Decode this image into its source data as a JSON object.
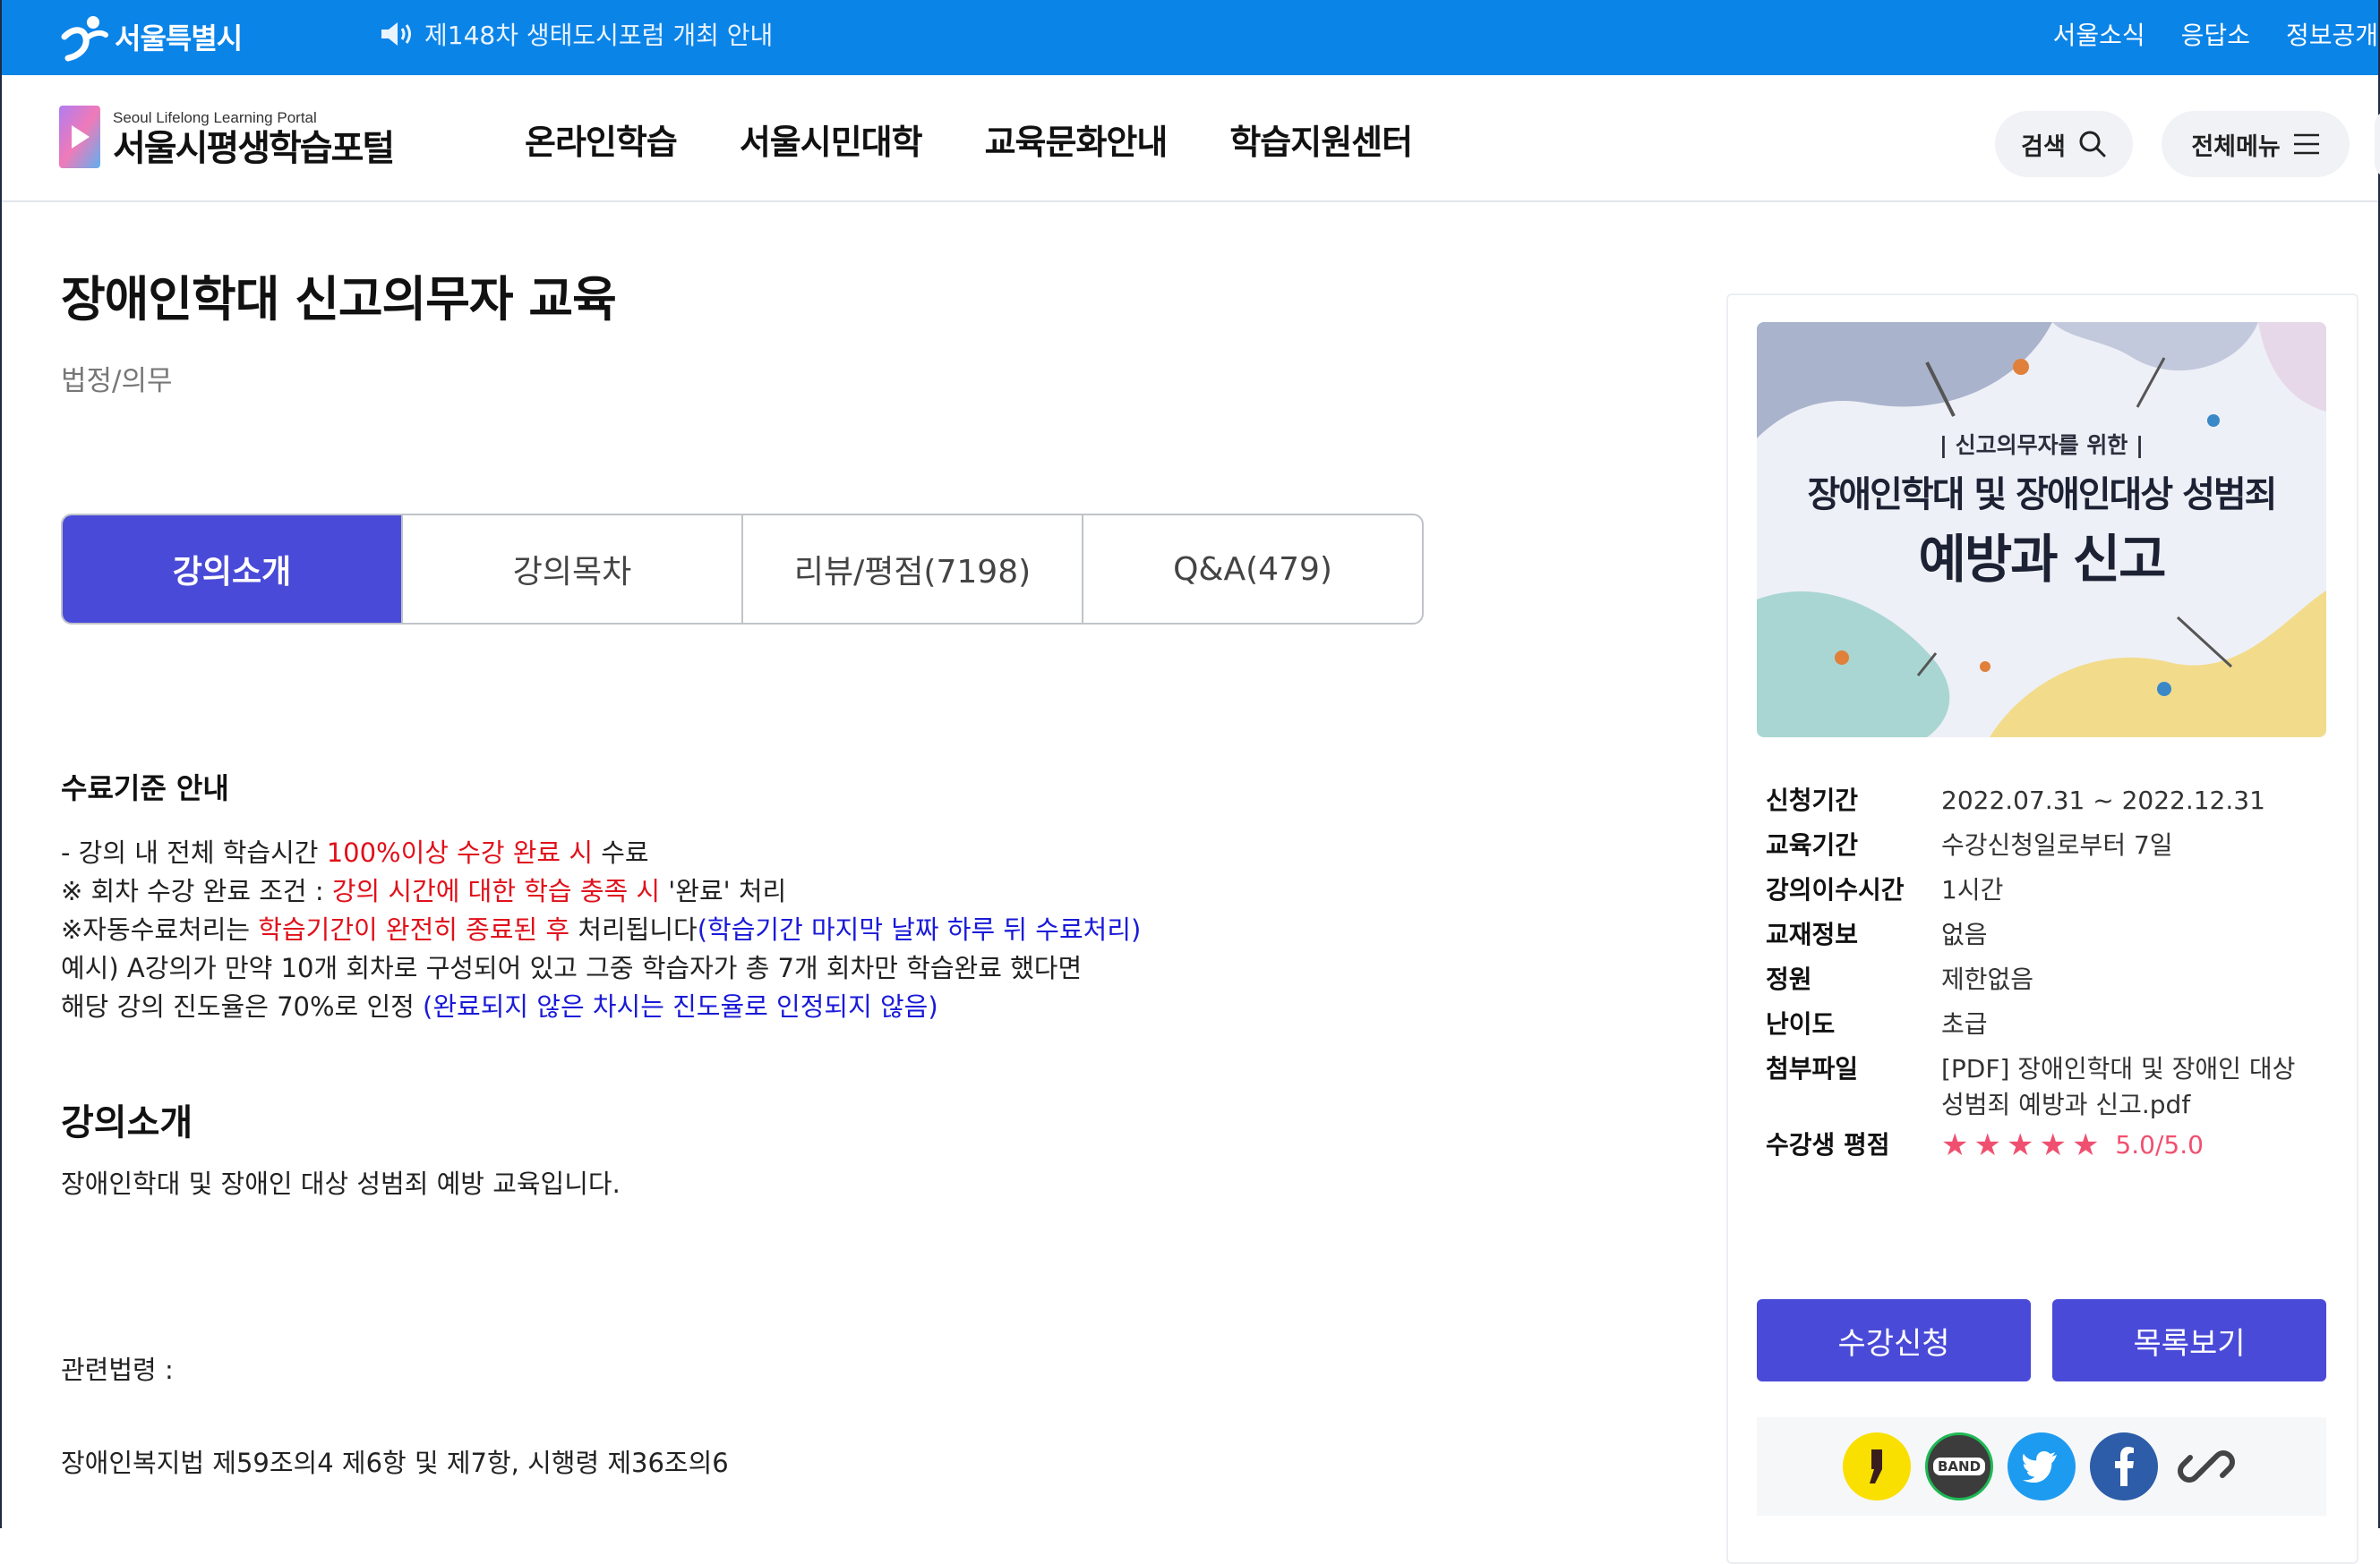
{
  "topbar": {
    "logo_text": "서울특별시",
    "notice": "제148차 생태도시포럼 개최 안내",
    "links": [
      "서울소식",
      "응답소",
      "정보공개"
    ]
  },
  "header": {
    "portal_sub": "Seoul Lifelong Learning Portal",
    "portal_name": "서울시평생학습포털",
    "nav": [
      "온라인학습",
      "서울시민대학",
      "교육문화안내",
      "학습지원센터"
    ],
    "search_label": "검색",
    "menu_label": "전체메뉴"
  },
  "course": {
    "title": "장애인학대 신고의무자 교육",
    "category": "법정/의무"
  },
  "tabs": [
    "강의소개",
    "강의목차",
    "리뷰/평점(7198)",
    "Q&A(479)"
  ],
  "criteria": {
    "title": "수료기준 안내",
    "l1a": "- 강의 내 전체 학습시간 ",
    "l1b": "100%이상 수강 완료 시",
    "l1c": " 수료",
    "l2a": "※ 회차 수강 완료 조건 : ",
    "l2b": "강의 시간에 대한 학습 충족 시",
    "l2c": " '완료' 처리",
    "l3a": "※자동수료처리는 ",
    "l3b": "학습기간이 완전히 종료된 후",
    "l3c": " 처리됩니다",
    "l3d": "(학습기간 마지막 날짜 하루 뒤 수료처리)",
    "l4": "예시) A강의가 만약 10개 회차로 구성되어 있고 그중 학습자가 총 7개 회차만 학습완료 했다면",
    "l5a": "해당 강의 진도율은 70%로 인정 ",
    "l5b": "(완료되지 않은 차시는 진도율로 인정되지 않음)"
  },
  "intro": {
    "title": "강의소개",
    "text": "장애인학대 및 장애인 대상 성범죄 예방 교육입니다.",
    "law_label": "관련법령 :",
    "law_text": "장애인복지법 제59조의4 제6항 및 제7항, 시행령 제36조의6"
  },
  "thumbnail": {
    "line1": "| 신고의무자를 위한 |",
    "line2": "장애인학대 및 장애인대상 성범죄",
    "line3": "예방과 신고"
  },
  "info": {
    "rows": [
      {
        "label": "신청기간",
        "value": "2022.07.31 ~ 2022.12.31"
      },
      {
        "label": "교육기간",
        "value": "수강신청일로부터 7일"
      },
      {
        "label": "강의이수시간",
        "value": "1시간"
      },
      {
        "label": "교재정보",
        "value": "없음"
      },
      {
        "label": "정원",
        "value": "제한없음"
      },
      {
        "label": "난이도",
        "value": "초급"
      },
      {
        "label": "첨부파일",
        "value": "[PDF] 장애인학대 및 장애인 대상 성범죄 예방과 신고.pdf"
      }
    ],
    "rating_label": "수강생 평점",
    "rating_stars": 5,
    "rating_text": "5.0/5.0"
  },
  "buttons": {
    "apply": "수강신청",
    "list": "목록보기"
  },
  "share": {
    "band_label": "BAND"
  },
  "colors": {
    "topbar": "#0b84e8",
    "accent": "#4a4ad8",
    "red_text": "#e0111b",
    "blue_text": "#1a1ad8",
    "star": "#f05070"
  }
}
